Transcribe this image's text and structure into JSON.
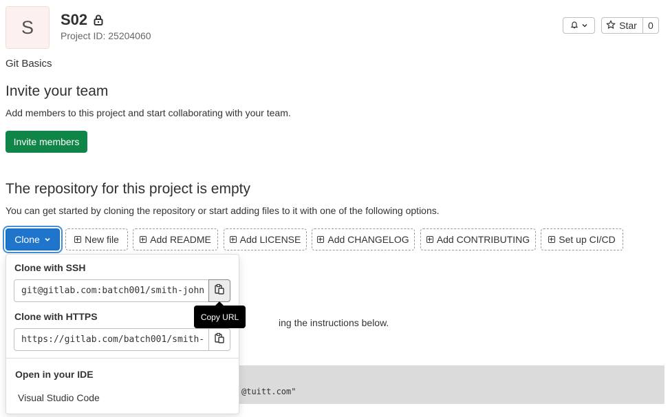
{
  "project": {
    "avatar_letter": "S",
    "title": "S02",
    "id_label": "Project ID: 25204060",
    "description": "Git Basics"
  },
  "header_actions": {
    "notifications_icon": "bell-icon",
    "star_label": "Star",
    "star_count": "0"
  },
  "invite": {
    "heading": "Invite your team",
    "text": "Add members to this project and start collaborating with your team.",
    "button_label": "Invite members"
  },
  "empty_repo": {
    "heading": "The repository for this project is empty",
    "text": "You can get started by cloning the repository or start adding files to it with one of the following options.",
    "clone_label": "Clone",
    "actions": [
      {
        "label": "New file"
      },
      {
        "label": "Add README"
      },
      {
        "label": "Add LICENSE"
      },
      {
        "label": "Add CHANGELOG"
      },
      {
        "label": "Add CONTRIBUTING"
      },
      {
        "label": "Set up CI/CD"
      }
    ]
  },
  "clone_dropdown": {
    "ssh_label": "Clone with SSH",
    "ssh_url": "git@gitlab.com:batch001/smith-john",
    "https_label": "Clone with HTTPS",
    "https_url": "https://gitlab.com/batch001/smith-",
    "ide_label": "Open in your IDE",
    "ide_option": "Visual Studio Code"
  },
  "tooltip": {
    "text": "Copy URL"
  },
  "background": {
    "instructions_fragment": "ing the instructions below.",
    "code_fragment": "@tuitt.com\""
  },
  "colors": {
    "primary": "#1f75cb",
    "success": "#108548",
    "code_bg": "#dbdbdb"
  }
}
